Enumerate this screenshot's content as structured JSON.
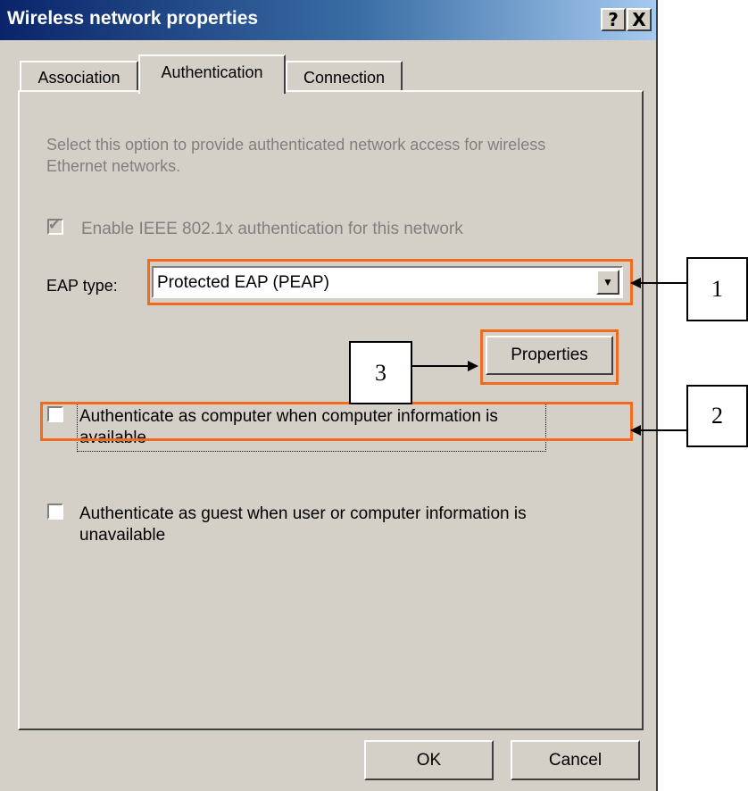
{
  "window": {
    "title": "Wireless network properties",
    "help_glyph": "?",
    "close_glyph": "X"
  },
  "tabs": [
    {
      "label": "Association",
      "active": false
    },
    {
      "label": "Authentication",
      "active": true
    },
    {
      "label": "Connection",
      "active": false
    }
  ],
  "auth": {
    "description": "Select this option to provide authenticated network access for wireless Ethernet networks.",
    "enable_ieee": {
      "label": "Enable IEEE 802.1x authentication for this network",
      "checked": true,
      "disabled": true
    },
    "eap_type_label": "EAP type:",
    "eap_type_value": "Protected EAP (PEAP)",
    "properties_button": "Properties",
    "auth_as_computer": {
      "label": "Authenticate as computer when computer information is available",
      "checked": false
    },
    "auth_as_guest": {
      "label": "Authenticate as guest when user or computer information is unavailable",
      "checked": false
    }
  },
  "footer": {
    "ok_label": "OK",
    "cancel_label": "Cancel"
  },
  "annotations": {
    "callout_1": "1",
    "callout_2": "2",
    "callout_3": "3",
    "highlight_color": "#f26b1d"
  },
  "icons": {
    "dropdown": "chevron-down-icon",
    "checkmark": "checkmark-icon"
  },
  "colors": {
    "titlebar_start": "#0a246a",
    "titlebar_end": "#a6caf0",
    "dialog_bg": "#d4d0c8",
    "disabled_text": "#808080"
  }
}
